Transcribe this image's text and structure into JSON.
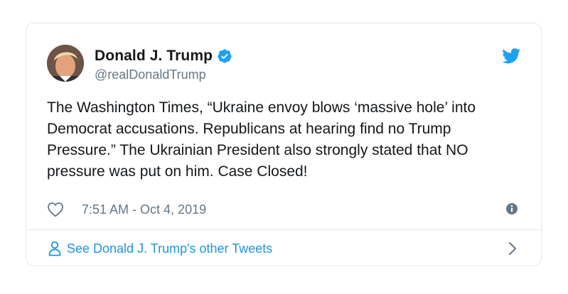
{
  "author": {
    "display_name": "Donald J. Trump",
    "handle": "@realDonaldTrump",
    "verified": true
  },
  "tweet": {
    "text": "The Washington Times, “Ukraine envoy blows ‘massive hole’ into Democrat accusations. Republicans at hearing find no Trump Pressure.” The Ukrainian President also strongly stated that NO pressure was put on him. Case Closed!",
    "timestamp": "7:51 AM - Oct 4, 2019"
  },
  "footer": {
    "link_text": "See Donald J. Trump's other Tweets"
  },
  "icons": {
    "brand": "twitter-bird-icon",
    "verified": "verified-badge-icon",
    "like": "heart-icon",
    "info": "info-icon",
    "profile": "person-icon",
    "chevron": "chevron-right-icon"
  },
  "colors": {
    "brand_blue": "#1da1f2",
    "link_blue": "#1b95e0",
    "text": "#14171a",
    "secondary_text": "#657786",
    "border": "#e1e8ed"
  }
}
